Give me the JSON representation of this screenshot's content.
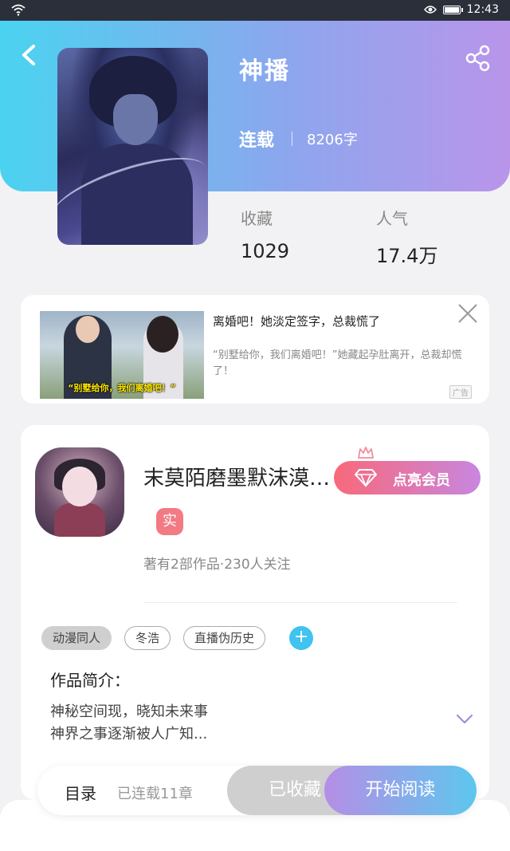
{
  "status_bar": {
    "time": "12:43",
    "battery_level": 0.9
  },
  "book": {
    "title": "神播",
    "serial_status": "连载",
    "word_count": "8206字",
    "favorites_label": "收藏",
    "favorites_value": "1029",
    "popularity_label": "人气",
    "popularity_value": "17.4万"
  },
  "ad": {
    "headline": "离婚吧！她淡定签字，总裁慌了",
    "description": "“别墅给你，我们离婚吧！”她藏起孕肚离开，总裁却慌了！",
    "image_caption": "“别墅给你，我们离婚吧！”",
    "ad_tag": "广告"
  },
  "author": {
    "name": "末莫陌磨墨默沫漠…",
    "verified_badge": "实",
    "meta": "著有2部作品·230人关注",
    "vip_button": "点亮会员"
  },
  "tags": [
    "动漫同人",
    "冬浩",
    "直播伪历史"
  ],
  "tag_add": "+",
  "intro": {
    "title": "作品简介：",
    "line1": "神秘空间现，晓知未来事",
    "line2": "神界之事逐渐被人广知..."
  },
  "action_bar": {
    "toc": "目录",
    "chapters": "已连载11章",
    "collected": "已收藏",
    "start_reading": "开始阅读"
  },
  "colors": {
    "header_start": "#4ad3f0",
    "header_end": "#b995ea",
    "vip_start": "#f8697a",
    "vip_end": "#c886e0",
    "tag_add": "#3fc3ef",
    "verified": "#f27a84"
  }
}
